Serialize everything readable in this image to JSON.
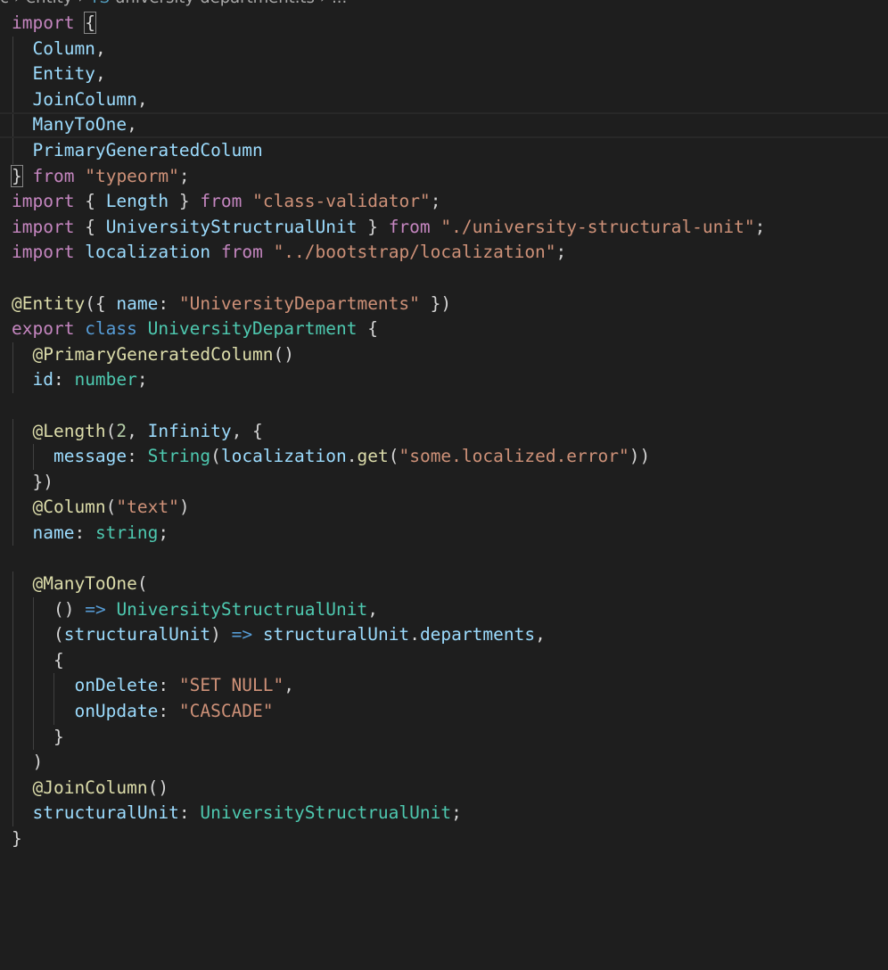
{
  "breadcrumb": [
    "c",
    "entity",
    "TS",
    "university-department.ts",
    "..."
  ],
  "code": {
    "lines": [
      {
        "indent": 0,
        "tokens": [
          [
            "kw",
            "import"
          ],
          [
            "pn",
            " "
          ],
          [
            "pn",
            "{"
          ]
        ]
      },
      {
        "indent": 1,
        "tokens": [
          [
            "vr",
            "Column"
          ],
          [
            "pn",
            ","
          ]
        ]
      },
      {
        "indent": 1,
        "tokens": [
          [
            "vr",
            "Entity"
          ],
          [
            "pn",
            ","
          ]
        ]
      },
      {
        "indent": 1,
        "tokens": [
          [
            "vr",
            "JoinColumn"
          ],
          [
            "pn",
            ","
          ]
        ]
      },
      {
        "indent": 1,
        "tokens": [
          [
            "vr",
            "ManyToOne"
          ],
          [
            "pn",
            ","
          ]
        ]
      },
      {
        "indent": 1,
        "tokens": [
          [
            "vr",
            "PrimaryGeneratedColumn"
          ]
        ]
      },
      {
        "indent": 0,
        "tokens": [
          [
            "pn",
            "}"
          ],
          [
            "pn",
            " "
          ],
          [
            "kw",
            "from"
          ],
          [
            "pn",
            " "
          ],
          [
            "str",
            "\"typeorm\""
          ],
          [
            "pn",
            ";"
          ]
        ]
      },
      {
        "indent": 0,
        "tokens": [
          [
            "kw",
            "import"
          ],
          [
            "pn",
            " { "
          ],
          [
            "vr",
            "Length"
          ],
          [
            "pn",
            " } "
          ],
          [
            "kw",
            "from"
          ],
          [
            "pn",
            " "
          ],
          [
            "str",
            "\"class-validator\""
          ],
          [
            "pn",
            ";"
          ]
        ]
      },
      {
        "indent": 0,
        "tokens": [
          [
            "kw",
            "import"
          ],
          [
            "pn",
            " { "
          ],
          [
            "vr",
            "UniversityStructrualUnit"
          ],
          [
            "pn",
            " } "
          ],
          [
            "kw",
            "from"
          ],
          [
            "pn",
            " "
          ],
          [
            "str",
            "\"./university-structural-unit\""
          ],
          [
            "pn",
            ";"
          ]
        ]
      },
      {
        "indent": 0,
        "tokens": [
          [
            "kw",
            "import"
          ],
          [
            "pn",
            " "
          ],
          [
            "vr",
            "localization"
          ],
          [
            "pn",
            " "
          ],
          [
            "kw",
            "from"
          ],
          [
            "pn",
            " "
          ],
          [
            "str",
            "\"../bootstrap/localization\""
          ],
          [
            "pn",
            ";"
          ]
        ]
      },
      {
        "indent": 0,
        "tokens": []
      },
      {
        "indent": 0,
        "tokens": [
          [
            "fn",
            "@Entity"
          ],
          [
            "pn",
            "({ "
          ],
          [
            "vr",
            "name"
          ],
          [
            "pn",
            ": "
          ],
          [
            "str",
            "\"UniversityDepartments\""
          ],
          [
            "pn",
            " })"
          ]
        ]
      },
      {
        "indent": 0,
        "tokens": [
          [
            "kw",
            "export"
          ],
          [
            "pn",
            " "
          ],
          [
            "st",
            "class"
          ],
          [
            "pn",
            " "
          ],
          [
            "ty",
            "UniversityDepartment"
          ],
          [
            "pn",
            " {"
          ]
        ]
      },
      {
        "indent": 1,
        "tokens": [
          [
            "fn",
            "@PrimaryGeneratedColumn"
          ],
          [
            "pn",
            "()"
          ]
        ]
      },
      {
        "indent": 1,
        "tokens": [
          [
            "vr",
            "id"
          ],
          [
            "pn",
            ": "
          ],
          [
            "ty",
            "number"
          ],
          [
            "pn",
            ";"
          ]
        ]
      },
      {
        "indent": 0,
        "tokens": []
      },
      {
        "indent": 1,
        "tokens": [
          [
            "fn",
            "@Length"
          ],
          [
            "pn",
            "("
          ],
          [
            "num",
            "2"
          ],
          [
            "pn",
            ", "
          ],
          [
            "vr",
            "Infinity"
          ],
          [
            "pn",
            ", {"
          ]
        ]
      },
      {
        "indent": 2,
        "tokens": [
          [
            "vr",
            "message"
          ],
          [
            "pn",
            ": "
          ],
          [
            "ty",
            "String"
          ],
          [
            "pn",
            "("
          ],
          [
            "vr",
            "localization"
          ],
          [
            "pn",
            "."
          ],
          [
            "fn",
            "get"
          ],
          [
            "pn",
            "("
          ],
          [
            "str",
            "\"some.localized.error\""
          ],
          [
            "pn",
            "))"
          ]
        ]
      },
      {
        "indent": 1,
        "tokens": [
          [
            "pn",
            "})"
          ]
        ]
      },
      {
        "indent": 1,
        "tokens": [
          [
            "fn",
            "@Column"
          ],
          [
            "pn",
            "("
          ],
          [
            "str",
            "\"text\""
          ],
          [
            "pn",
            ")"
          ]
        ]
      },
      {
        "indent": 1,
        "tokens": [
          [
            "vr",
            "name"
          ],
          [
            "pn",
            ": "
          ],
          [
            "ty",
            "string"
          ],
          [
            "pn",
            ";"
          ]
        ]
      },
      {
        "indent": 0,
        "tokens": []
      },
      {
        "indent": 1,
        "tokens": [
          [
            "fn",
            "@ManyToOne"
          ],
          [
            "pn",
            "("
          ]
        ]
      },
      {
        "indent": 2,
        "tokens": [
          [
            "pn",
            "() "
          ],
          [
            "st",
            "=>"
          ],
          [
            "pn",
            " "
          ],
          [
            "ty",
            "UniversityStructrualUnit"
          ],
          [
            "pn",
            ","
          ]
        ]
      },
      {
        "indent": 2,
        "tokens": [
          [
            "pn",
            "("
          ],
          [
            "vr",
            "structuralUnit"
          ],
          [
            "pn",
            ") "
          ],
          [
            "st",
            "=>"
          ],
          [
            "pn",
            " "
          ],
          [
            "vr",
            "structuralUnit"
          ],
          [
            "pn",
            "."
          ],
          [
            "vr",
            "departments"
          ],
          [
            "pn",
            ","
          ]
        ]
      },
      {
        "indent": 2,
        "tokens": [
          [
            "pn",
            "{"
          ]
        ]
      },
      {
        "indent": 3,
        "tokens": [
          [
            "vr",
            "onDelete"
          ],
          [
            "pn",
            ": "
          ],
          [
            "str",
            "\"SET NULL\""
          ],
          [
            "pn",
            ","
          ]
        ]
      },
      {
        "indent": 3,
        "tokens": [
          [
            "vr",
            "onUpdate"
          ],
          [
            "pn",
            ": "
          ],
          [
            "str",
            "\"CASCADE\""
          ]
        ]
      },
      {
        "indent": 2,
        "tokens": [
          [
            "pn",
            "}"
          ]
        ]
      },
      {
        "indent": 1,
        "tokens": [
          [
            "pn",
            ")"
          ]
        ]
      },
      {
        "indent": 1,
        "tokens": [
          [
            "fn",
            "@JoinColumn"
          ],
          [
            "pn",
            "()"
          ]
        ]
      },
      {
        "indent": 1,
        "tokens": [
          [
            "vr",
            "structuralUnit"
          ],
          [
            "pn",
            ": "
          ],
          [
            "ty",
            "UniversityStructrualUnit"
          ],
          [
            "pn",
            ";"
          ]
        ]
      },
      {
        "indent": 0,
        "tokens": [
          [
            "pn",
            "}"
          ]
        ]
      }
    ]
  }
}
